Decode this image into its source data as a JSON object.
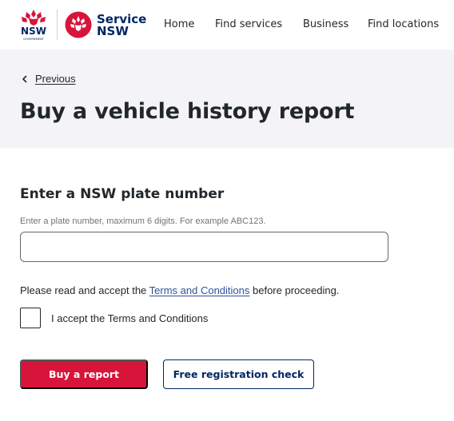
{
  "header": {
    "nsw_logo": {
      "wordmark": "NSW",
      "subtext": "GOVERNMENT",
      "icon": "waratah-logo-icon"
    },
    "service_nsw_logo": {
      "line1": "Service",
      "line2": "NSW",
      "icon": "service-nsw-mark-icon"
    },
    "nav": [
      {
        "label": "Home"
      },
      {
        "label": "Find services"
      },
      {
        "label": "Business"
      },
      {
        "label": "Find locations"
      }
    ]
  },
  "banner": {
    "back_label": "Previous",
    "back_icon": "chevron-left-icon",
    "title": "Buy a vehicle history report"
  },
  "form": {
    "section_title": "Enter a NSW plate number",
    "hint": "Enter a plate number, maximum 6 digits. For example ABC123.",
    "plate_value": "",
    "terms_prefix": "Please read and accept the ",
    "terms_link": "Terms and Conditions",
    "terms_suffix": " before proceeding.",
    "checkbox_checked": false,
    "checkbox_label": "I accept the Terms and Conditions",
    "primary_button": "Buy a report",
    "secondary_button": "Free registration check"
  },
  "colors": {
    "brand_red": "#d7153a",
    "brand_navy": "#002664",
    "banner_bg": "#f4f4f7",
    "link": "#2e5299"
  }
}
